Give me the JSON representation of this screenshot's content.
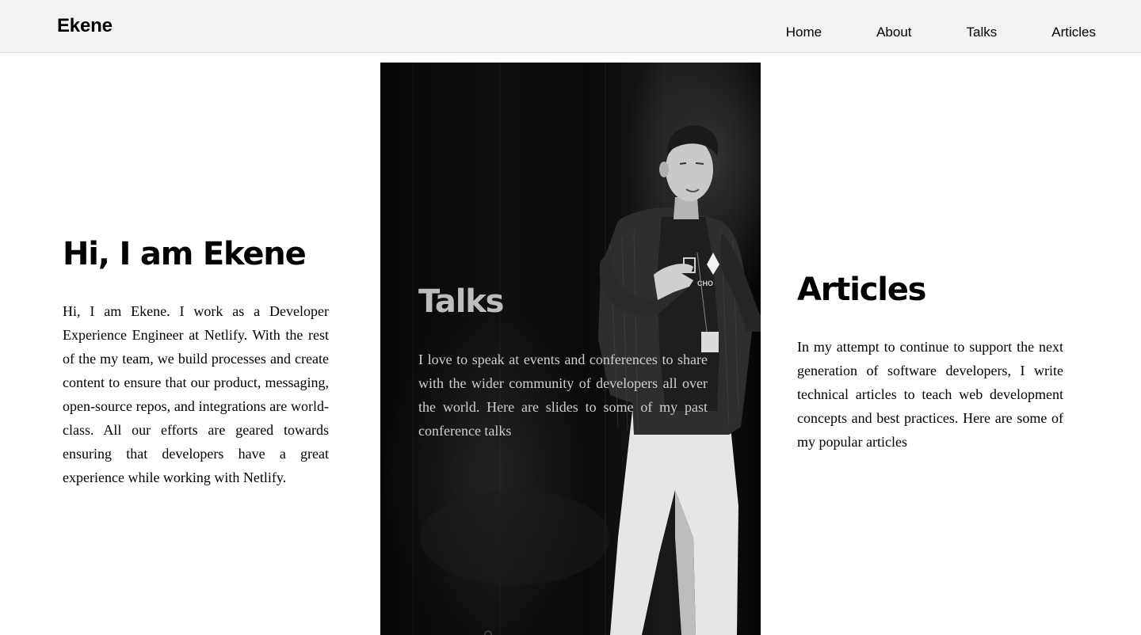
{
  "header": {
    "brand": "Ekene",
    "nav": [
      "Home",
      "About",
      "Talks",
      "Articles"
    ]
  },
  "intro": {
    "title": "Hi, I am Ekene",
    "text": "Hi, I am Ekene. I work as a Developer Experience Engineer at Netlify. With the rest of the my team, we build processes and create content to ensure that our product, messaging, open-source repos, and integrations are world-class. All our efforts are geared towards ensuring that developers have a great experience while working with Netlify."
  },
  "talks": {
    "title": "Talks",
    "text": "I love to speak at events and conferences to share with the wider community of developers all over the world. Here are slides to some of my past conference talks"
  },
  "articles": {
    "title": "Articles",
    "text": "In my attempt to continue to support the next generation of software developers, I write technical articles to teach web development concepts and best practices. Here are some of my popular articles"
  },
  "colors": {
    "header_bg": "#f2f2f2",
    "text": "#000000",
    "talks_heading": "#bdbdbd",
    "talks_text": "#cfcfcf"
  }
}
